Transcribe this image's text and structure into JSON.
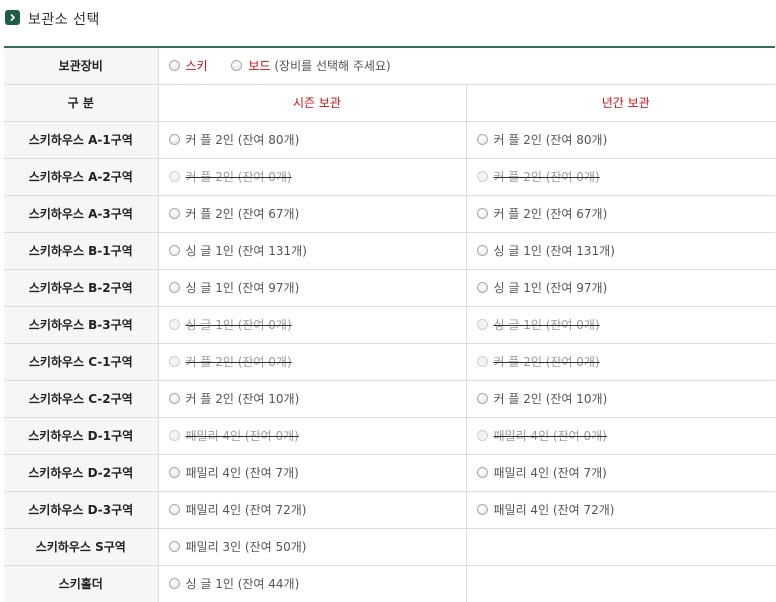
{
  "title": "보관소 선택",
  "gear": {
    "label": "보관장비",
    "options": [
      {
        "label": "스키"
      },
      {
        "label": "보드"
      }
    ],
    "hint": "(장비를 선택해 주세요)"
  },
  "header": {
    "label": "구 분",
    "season": "시즌 보관",
    "year": "년간 보관"
  },
  "rows": [
    {
      "name": "스키하우스 A-1구역",
      "season": "커 플 2인 (잔여 80개)",
      "season_disabled": false,
      "year": "커 플 2인 (잔여 80개)",
      "year_disabled": false
    },
    {
      "name": "스키하우스 A-2구역",
      "season": "커 플 2인 (잔여 0개)",
      "season_disabled": true,
      "year": "커 플 2인 (잔여 0개)",
      "year_disabled": true
    },
    {
      "name": "스키하우스 A-3구역",
      "season": "커 플 2인 (잔여 67개)",
      "season_disabled": false,
      "year": "커 플 2인 (잔여 67개)",
      "year_disabled": false
    },
    {
      "name": "스키하우스 B-1구역",
      "season": "싱 글 1인 (잔여 131개)",
      "season_disabled": false,
      "year": "싱 글 1인 (잔여 131개)",
      "year_disabled": false
    },
    {
      "name": "스키하우스 B-2구역",
      "season": "싱 글 1인 (잔여 97개)",
      "season_disabled": false,
      "year": "싱 글 1인 (잔여 97개)",
      "year_disabled": false
    },
    {
      "name": "스키하우스 B-3구역",
      "season": "싱 글 1인 (잔여 0개)",
      "season_disabled": true,
      "year": "싱 글 1인 (잔여 0개)",
      "year_disabled": true
    },
    {
      "name": "스키하우스 C-1구역",
      "season": "커 플 2인 (잔여 0개)",
      "season_disabled": true,
      "year": "커 플 2인 (잔여 0개)",
      "year_disabled": true
    },
    {
      "name": "스키하우스 C-2구역",
      "season": "커 플 2인 (잔여 10개)",
      "season_disabled": false,
      "year": "커 플 2인 (잔여 10개)",
      "year_disabled": false
    },
    {
      "name": "스키하우스 D-1구역",
      "season": "패밀리 4인 (잔여 0개)",
      "season_disabled": true,
      "year": "패밀리 4인 (잔여 0개)",
      "year_disabled": true
    },
    {
      "name": "스키하우스 D-2구역",
      "season": "패밀리 4인 (잔여 7개)",
      "season_disabled": false,
      "year": "패밀리 4인 (잔여 7개)",
      "year_disabled": false
    },
    {
      "name": "스키하우스 D-3구역",
      "season": "패밀리 4인 (잔여 72개)",
      "season_disabled": false,
      "year": "패밀리 4인 (잔여 72개)",
      "year_disabled": false
    },
    {
      "name": "스키하우스 S구역",
      "season": "패밀리 3인 (잔여 50개)",
      "season_disabled": false,
      "year": "",
      "year_disabled": false
    },
    {
      "name": "스키홀더",
      "season": "싱 글 1인 (잔여 44개)",
      "season_disabled": false,
      "year": "",
      "year_disabled": false
    }
  ],
  "colors": {
    "accent": "#2f6f5b",
    "label_red": "#c0151a",
    "header_bg": "#f6f6f6"
  }
}
